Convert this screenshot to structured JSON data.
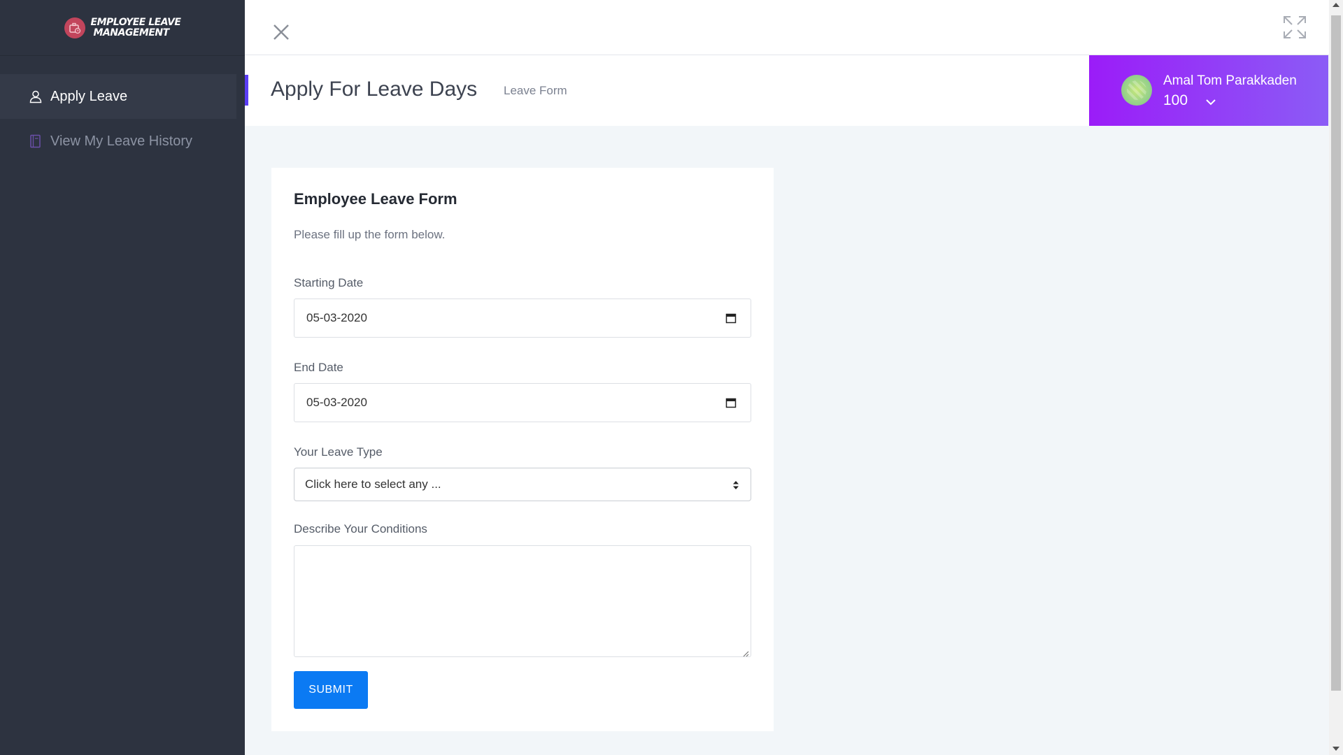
{
  "app": {
    "logo_line1": "Employee Leave",
    "logo_line2": "Management"
  },
  "sidebar": {
    "items": [
      {
        "label": "Apply Leave",
        "icon": "user-icon",
        "active": true
      },
      {
        "label": "View My Leave History",
        "icon": "book-icon",
        "active": false
      }
    ]
  },
  "header": {
    "title": "Apply For Leave Days",
    "subtitle": "Leave Form"
  },
  "user": {
    "name": "Amal Tom Parakkaden",
    "id": "100"
  },
  "form": {
    "title": "Employee Leave Form",
    "description": "Please fill up the form below.",
    "start_label": "Starting Date",
    "start_value": "05-03-2020",
    "end_label": "End Date",
    "end_value": "05-03-2020",
    "type_label": "Your Leave Type",
    "type_value": "Click here to select any ...",
    "conditions_label": "Describe Your Conditions",
    "conditions_value": "",
    "submit_label": "SUBMIT"
  },
  "colors": {
    "sidebar_bg": "#2d3340",
    "accent": "#5b3df5",
    "user_panel_start": "#9b1cf8",
    "user_panel_end": "#8b5cf6",
    "submit": "#0b7af3"
  }
}
